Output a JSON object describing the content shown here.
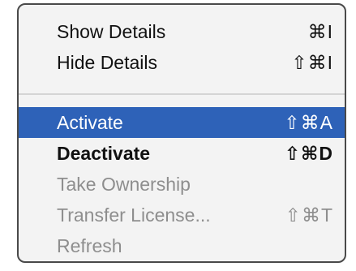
{
  "menu": {
    "group1": [
      {
        "label": "Show Details",
        "shortcut": "⌘I"
      },
      {
        "label": "Hide Details",
        "shortcut": "⇧⌘I"
      }
    ],
    "group2": [
      {
        "label": "Activate",
        "shortcut": "⇧⌘A",
        "state": "selected"
      },
      {
        "label": "Deactivate",
        "shortcut": "⇧⌘D",
        "state": "normal"
      },
      {
        "label": "Take Ownership",
        "shortcut": "",
        "state": "disabled"
      },
      {
        "label": "Transfer License...",
        "shortcut": "⇧⌘T",
        "state": "disabled"
      },
      {
        "label": "Refresh",
        "shortcut": "",
        "state": "disabled"
      }
    ]
  },
  "colors": {
    "selection": "#2e62b8",
    "menu_background": "#f3f3f3",
    "disabled_text": "#8e8e8e",
    "border": "#4a4a4a"
  }
}
